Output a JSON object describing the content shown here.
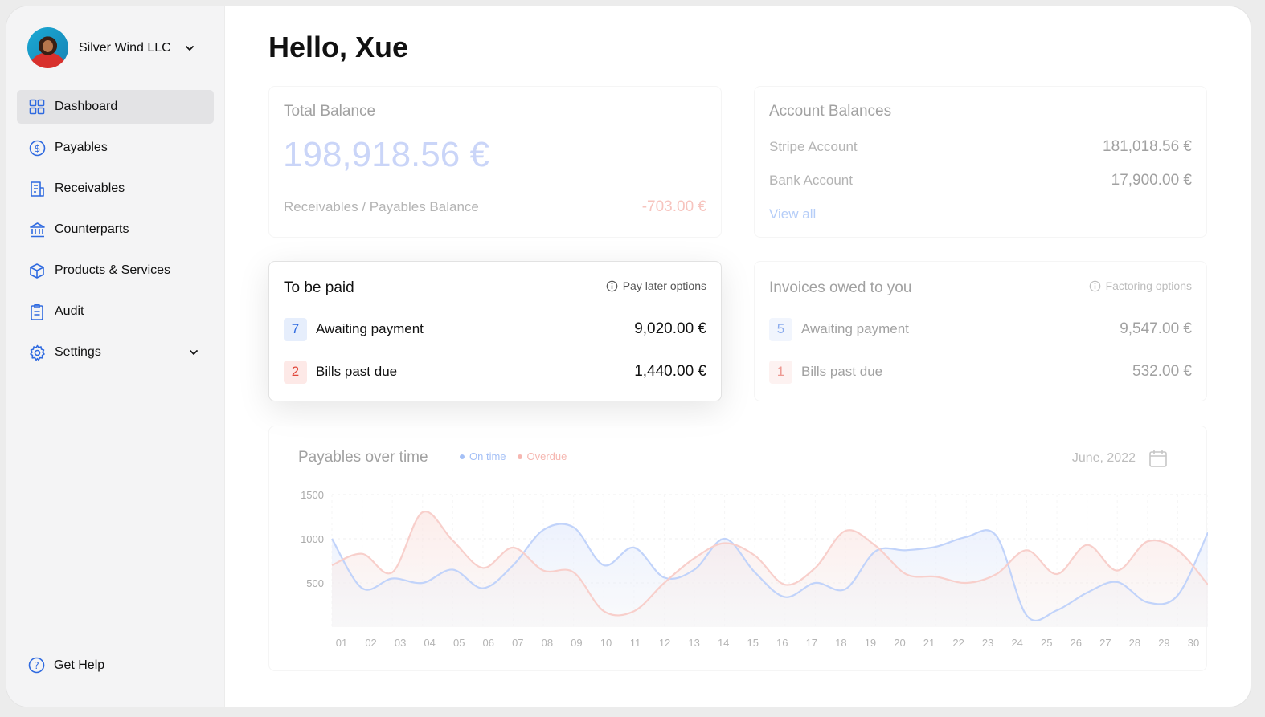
{
  "sidebar": {
    "org_name": "Silver Wind LLC",
    "items": [
      {
        "label": "Dashboard",
        "icon": "grid-icon",
        "active": true
      },
      {
        "label": "Payables",
        "icon": "dollar-circle-icon"
      },
      {
        "label": "Receivables",
        "icon": "receipt-icon"
      },
      {
        "label": "Counterparts",
        "icon": "bank-icon"
      },
      {
        "label": "Products & Services",
        "icon": "box-icon"
      },
      {
        "label": "Audit",
        "icon": "clipboard-icon"
      },
      {
        "label": "Settings",
        "icon": "gear-icon"
      }
    ],
    "help_label": "Get Help"
  },
  "greeting": "Hello, Xue",
  "total_balance": {
    "title": "Total Balance",
    "amount": "198,918.56 €",
    "sub_label": "Receivables / Payables Balance",
    "sub_value": "-703.00 €"
  },
  "account_balances": {
    "title": "Account Balances",
    "rows": [
      {
        "label": "Stripe Account",
        "value": "181,018.56 €"
      },
      {
        "label": "Bank Account",
        "value": "17,900.00 €"
      }
    ],
    "view_all": "View all"
  },
  "to_be_paid": {
    "title": "To be paid",
    "option": "Pay later options",
    "rows": [
      {
        "count": "7",
        "label": "Awaiting payment",
        "value": "9,020.00 €"
      },
      {
        "count": "2",
        "label": "Bills past due",
        "value": "1,440.00 €"
      }
    ]
  },
  "invoices_owed": {
    "title": "Invoices owed to you",
    "option": "Factoring options",
    "rows": [
      {
        "count": "5",
        "label": "Awaiting payment",
        "value": "9,547.00 €"
      },
      {
        "count": "1",
        "label": "Bills past due",
        "value": "532.00 €"
      }
    ]
  },
  "chart": {
    "title": "Payables over time",
    "legend": [
      "On time",
      "Overdue"
    ],
    "date": "June, 2022"
  },
  "colors": {
    "on_time": "#8fb0f7",
    "overdue": "#f3a9a2",
    "accent": "#2f6ae0"
  },
  "chart_data": {
    "type": "area",
    "title": "Payables over time",
    "xlabel": "",
    "ylabel": "",
    "x": [
      "01",
      "02",
      "03",
      "04",
      "05",
      "06",
      "07",
      "08",
      "09",
      "10",
      "11",
      "12",
      "13",
      "14",
      "15",
      "16",
      "17",
      "18",
      "19",
      "20",
      "21",
      "22",
      "23",
      "24",
      "25",
      "26",
      "27",
      "28",
      "29",
      "30"
    ],
    "yticks": [
      500,
      1000,
      1500
    ],
    "ylim": [
      0,
      1500
    ],
    "grid": true,
    "series": [
      {
        "name": "On time",
        "values": [
          1000,
          440,
          550,
          500,
          650,
          440,
          700,
          1100,
          1130,
          700,
          900,
          560,
          650,
          1000,
          620,
          340,
          500,
          430,
          860,
          870,
          910,
          1020,
          1030,
          130,
          190,
          390,
          510,
          280,
          360,
          1070
        ]
      },
      {
        "name": "Overdue",
        "values": [
          700,
          830,
          620,
          1300,
          980,
          670,
          900,
          640,
          620,
          180,
          180,
          500,
          780,
          950,
          810,
          480,
          670,
          1090,
          920,
          600,
          570,
          500,
          600,
          870,
          600,
          930,
          640,
          970,
          870,
          480
        ]
      }
    ]
  }
}
